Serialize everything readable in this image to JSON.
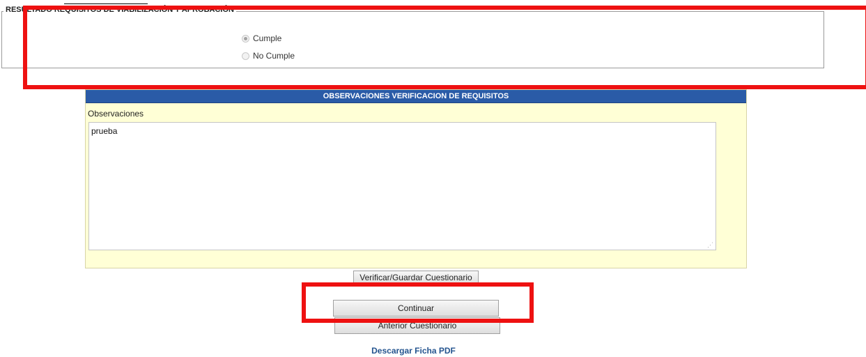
{
  "result_section": {
    "legend": "RESULTADO REQUISITOS DE VIABILIZACIÓN Y APROBACIÓN",
    "options": [
      {
        "label": "Cumple",
        "selected": true
      },
      {
        "label": "No Cumple",
        "selected": false
      }
    ]
  },
  "observations": {
    "header": "OBSERVACIONES VERIFICACION DE REQUISITOS",
    "label": "Observaciones",
    "value": "prueba"
  },
  "buttons": {
    "verify_save": "Verificar/Guardar Cuestionario",
    "continue": "Continuar",
    "previous": "Anterior Cuestionario"
  },
  "links": {
    "download_pdf": "Descargar Ficha PDF"
  },
  "colors": {
    "highlight": "#ee1111",
    "header_bg": "#2a5ba7",
    "panel_bg": "#ffffd6",
    "link": "#24548f"
  }
}
